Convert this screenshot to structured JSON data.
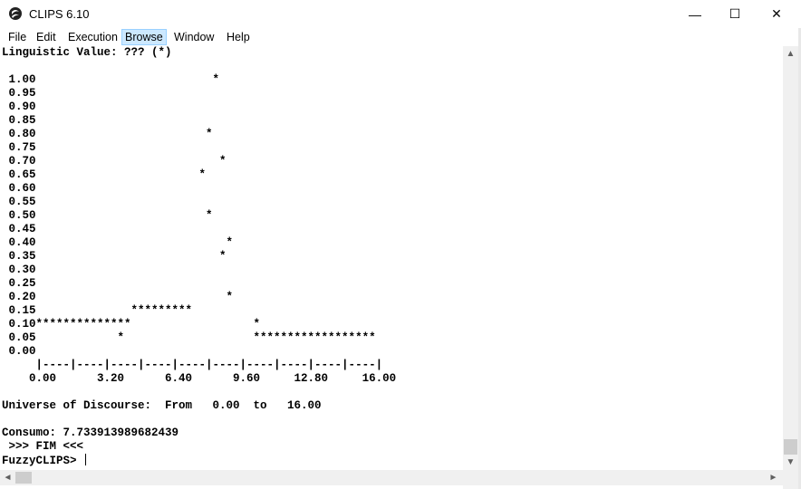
{
  "window": {
    "title": "CLIPS 6.10",
    "icon": "clips-app-icon",
    "minimize_glyph": "—",
    "maximize_glyph": "☐",
    "close_glyph": "✕"
  },
  "menu": [
    "File",
    "Edit",
    "Execution",
    "Browse",
    "Window",
    "Help"
  ],
  "console_lines": [
    "Linguistic Value: ??? (*)",
    "",
    " 1.00                          *",
    " 0.95",
    " 0.90",
    " 0.85",
    " 0.80                         *",
    " 0.75",
    " 0.70                           *",
    " 0.65                        *",
    " 0.60",
    " 0.55",
    " 0.50                         *",
    " 0.45",
    " 0.40                            *",
    " 0.35                           *",
    " 0.30",
    " 0.25",
    " 0.20                            *",
    " 0.15              *********",
    " 0.10**************                  *",
    " 0.05            *                   ******************",
    " 0.00",
    "     |----|----|----|----|----|----|----|----|----|----|",
    "    0.00      3.20      6.40      9.60     12.80     16.00",
    "",
    "Universe of Discourse:  From   0.00  to   16.00",
    "",
    "Consumo: 7.733913989682439",
    " >>> FIM <<<"
  ],
  "prompt": "FuzzyCLIPS> ",
  "scroll": {
    "up": "▲",
    "down": "▼",
    "left": "◄",
    "right": "►"
  }
}
